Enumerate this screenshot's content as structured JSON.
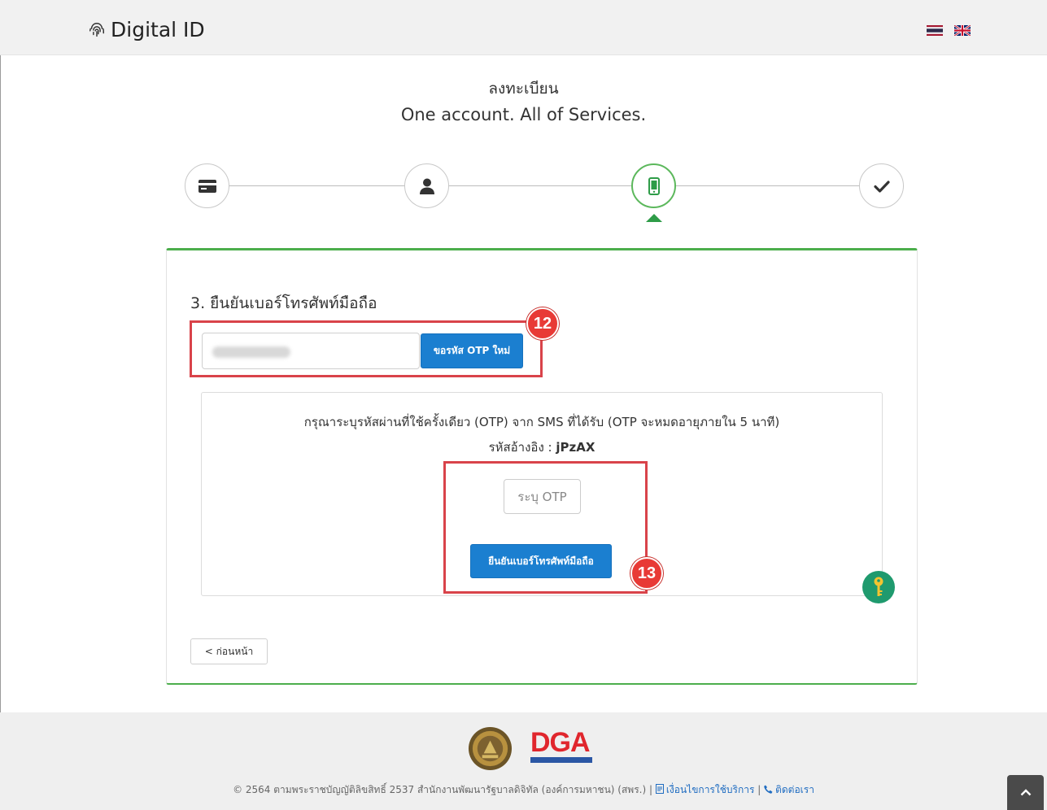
{
  "header": {
    "brand_text": "Digital ID",
    "brand_icon": "fingerprint-icon",
    "languages": [
      "th",
      "en"
    ]
  },
  "page": {
    "title_th": "ลงทะเบียน",
    "subtitle": "One account. All of Services."
  },
  "steps": [
    {
      "icon": "id-card-icon",
      "state": "done"
    },
    {
      "icon": "user-icon",
      "state": "done"
    },
    {
      "icon": "mobile-icon",
      "state": "active"
    },
    {
      "icon": "check-icon",
      "state": "pending"
    }
  ],
  "form": {
    "heading": "3. ยืนยันเบอร์โทรศัพท์มือถือ",
    "phone_value": "",
    "request_otp_label": "ขอรหัส OTP ใหม่",
    "otp_instruction": "กรุณาระบุรหัสผ่านที่ใช้ครั้งเดียว (OTP) จาก SMS ที่ได้รับ (OTP จะหมดอายุภายใน 5 นาที)",
    "ref_label": "รหัสอ้างอิง : ",
    "ref_code": "jPzAX",
    "otp_placeholder": "ระบุ OTP",
    "confirm_label": "ยืนยันเบอร์โทรศัพท์มือถือ",
    "back_label": "< ก่อนหน้า"
  },
  "annotations": {
    "badge_a": "12",
    "badge_b": "13"
  },
  "footer": {
    "logo_text": "DGA",
    "copyright": "© 2564 ตามพระราชบัญญัติลิขสิทธิ์ 2537 สำนักงานพัฒนารัฐบาลดิจิทัล (องค์การมหาชน) (สพร.) | ",
    "terms_label": "เงื่อนไขการใช้บริการ",
    "separator": " | ",
    "contact_label": "ติดต่อเรา"
  },
  "colors": {
    "primary": "#1b7fd0",
    "success": "#4cae4c",
    "highlight": "#d9434a",
    "badge": "#e83a36",
    "dga_red": "#e0262d",
    "dga_blue": "#2b57a5"
  }
}
